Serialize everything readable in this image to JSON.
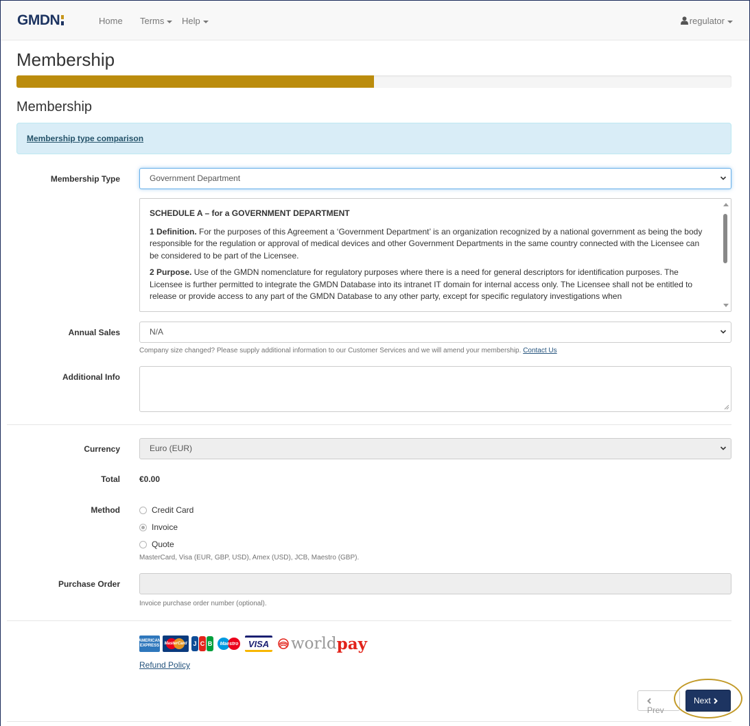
{
  "navbar": {
    "brand_main": "GMDN",
    "brand_accent": "",
    "home": "Home",
    "terms": "Terms",
    "help": "Help",
    "user": "regulator"
  },
  "page": {
    "title": "Membership",
    "progress_percent": 50,
    "section_title": "Membership",
    "comparison_link": "Membership type comparison"
  },
  "form": {
    "membership_type_label": "Membership Type",
    "membership_type_value": "Government Department",
    "schedule": {
      "heading": "SCHEDULE A – for a GOVERNMENT DEPARTMENT",
      "p1_title": "1 Definition.",
      "p1_text": " For the purposes of this Agreement a ‘Government Department’ is an organization recognized by a national government as being the body responsible for the regulation or approval of medical devices and other Government Departments in the same country connected with the Licensee can be considered to be part of the Licensee.",
      "p2_title": "2 Purpose.",
      "p2_text": " Use of the GMDN nomenclature for regulatory purposes where there is a need for general descriptors for identification purposes. The Licensee is further permitted to integrate the GMDN Database into its intranet IT domain for internal access only. The Licensee shall not be entitled to release or provide access to any part of the GMDN Database to any other party, except for specific regulatory investigations when"
    },
    "annual_sales_label": "Annual Sales",
    "annual_sales_value": "N/A",
    "annual_sales_help": "Company size changed? Please supply additional information to our Customer Services and we will amend your membership.",
    "contact_us": "Contact Us",
    "additional_info_label": "Additional Info",
    "additional_info_value": "",
    "currency_label": "Currency",
    "currency_value": "Euro (EUR)",
    "total_label": "Total",
    "total_value": "€0.00",
    "method_label": "Method",
    "methods": [
      "Credit Card",
      "Invoice",
      "Quote"
    ],
    "method_selected": "Invoice",
    "method_help": "MasterCard, Visa (EUR, GBP, USD), Amex (USD), JCB, Maestro (GBP).",
    "po_label": "Purchase Order",
    "po_value": "",
    "po_help": "Invoice purchase order number (optional)."
  },
  "payment_logos": {
    "amex": "AMERICAN EXPRESS",
    "mastercard": "MasterCard",
    "jcb": [
      "J",
      "C",
      "B"
    ],
    "maestro": "Maestro",
    "visa": "VISA",
    "worldpay_world": "world",
    "worldpay_pay": "pay"
  },
  "footer": {
    "refund_policy": "Refund Policy",
    "prev": "Prev",
    "next": "Next"
  },
  "colors": {
    "brand_navy": "#1d3461",
    "brand_gold": "#c7961b",
    "progress": "#bb8c0d",
    "alert_bg": "#d9edf7"
  }
}
